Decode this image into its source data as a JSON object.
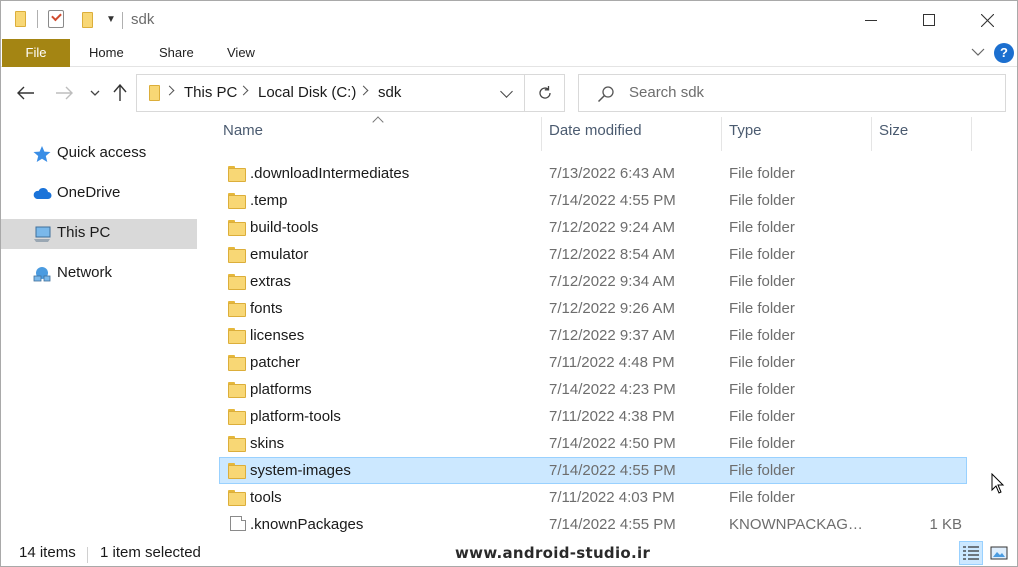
{
  "window": {
    "title": "sdk",
    "controls": {
      "minimize": "minimize",
      "maximize": "maximize",
      "close": "close"
    }
  },
  "ribbon": {
    "tabs": [
      {
        "label": "File"
      },
      {
        "label": "Home"
      },
      {
        "label": "Share"
      },
      {
        "label": "View"
      }
    ],
    "help_label": "?"
  },
  "address": {
    "breadcrumbs": [
      "This PC",
      "Local Disk (C:)",
      "sdk"
    ]
  },
  "search": {
    "placeholder": "Search sdk"
  },
  "sidebar": {
    "items": [
      {
        "label": "Quick access",
        "icon": "star-icon"
      },
      {
        "label": "OneDrive",
        "icon": "cloud-icon"
      },
      {
        "label": "This PC",
        "icon": "computer-icon",
        "selected": true
      },
      {
        "label": "Network",
        "icon": "network-icon"
      }
    ]
  },
  "columns": {
    "name": "Name",
    "date": "Date modified",
    "type": "Type",
    "size": "Size"
  },
  "files": [
    {
      "name": ".downloadIntermediates",
      "date": "7/13/2022 6:43 AM",
      "type": "File folder",
      "size": "",
      "icon": "folder-icon"
    },
    {
      "name": ".temp",
      "date": "7/14/2022 4:55 PM",
      "type": "File folder",
      "size": "",
      "icon": "folder-icon"
    },
    {
      "name": "build-tools",
      "date": "7/12/2022 9:24 AM",
      "type": "File folder",
      "size": "",
      "icon": "folder-icon"
    },
    {
      "name": "emulator",
      "date": "7/12/2022 8:54 AM",
      "type": "File folder",
      "size": "",
      "icon": "folder-icon"
    },
    {
      "name": "extras",
      "date": "7/12/2022 9:34 AM",
      "type": "File folder",
      "size": "",
      "icon": "folder-icon"
    },
    {
      "name": "fonts",
      "date": "7/12/2022 9:26 AM",
      "type": "File folder",
      "size": "",
      "icon": "folder-icon"
    },
    {
      "name": "licenses",
      "date": "7/12/2022 9:37 AM",
      "type": "File folder",
      "size": "",
      "icon": "folder-icon"
    },
    {
      "name": "patcher",
      "date": "7/11/2022 4:48 PM",
      "type": "File folder",
      "size": "",
      "icon": "folder-icon"
    },
    {
      "name": "platforms",
      "date": "7/14/2022 4:23 PM",
      "type": "File folder",
      "size": "",
      "icon": "folder-icon"
    },
    {
      "name": "platform-tools",
      "date": "7/11/2022 4:38 PM",
      "type": "File folder",
      "size": "",
      "icon": "folder-icon"
    },
    {
      "name": "skins",
      "date": "7/14/2022 4:50 PM",
      "type": "File folder",
      "size": "",
      "icon": "folder-icon"
    },
    {
      "name": "system-images",
      "date": "7/14/2022 4:55 PM",
      "type": "File folder",
      "size": "",
      "icon": "folder-icon",
      "selected": true
    },
    {
      "name": "tools",
      "date": "7/11/2022 4:03 PM",
      "type": "File folder",
      "size": "",
      "icon": "folder-icon"
    },
    {
      "name": ".knownPackages",
      "date": "7/14/2022 4:55 PM",
      "type": "KNOWNPACKAGE...",
      "size": "1 KB",
      "icon": "file-icon"
    }
  ],
  "status": {
    "item_count": "14 items",
    "selection": "1 item selected"
  },
  "watermark": "www.android-studio.ir",
  "colors": {
    "file_tab": "#a48513",
    "selection_bg": "#cce8ff",
    "selection_border": "#99d1ff",
    "sidebar_selected": "#d9d9d9",
    "folder": "#f8d775"
  }
}
